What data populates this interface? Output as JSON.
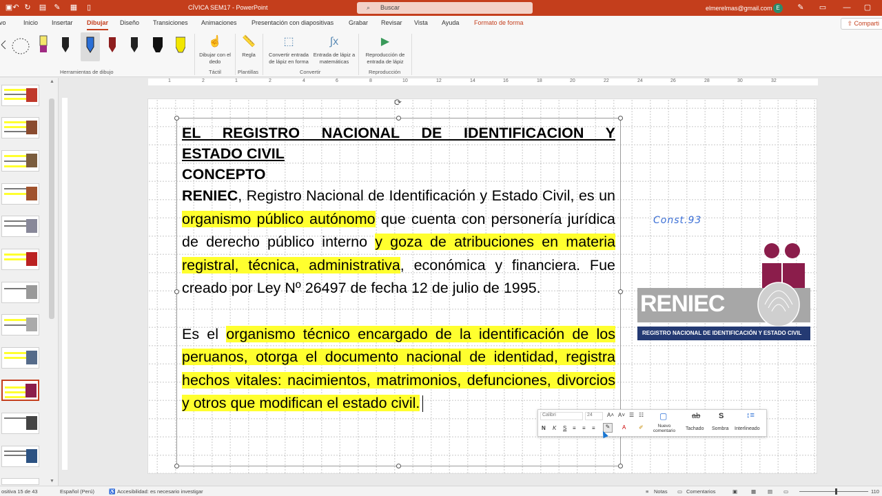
{
  "titlebar": {
    "doc_title": "CÍVICA SEM17  -  PowerPoint",
    "search_placeholder": "Buscar",
    "user_email": "elmerelmas@gmail.com",
    "user_initial": "E"
  },
  "ribbon_tabs": [
    "ivo",
    "Inicio",
    "Insertar",
    "Dibujar",
    "Diseño",
    "Transiciones",
    "Animaciones",
    "Presentación con diapositivas",
    "Grabar",
    "Revisar",
    "Vista",
    "Ayuda",
    "Formato de forma"
  ],
  "active_tab": "Dibujar",
  "share_label": "Comparti",
  "ribbon": {
    "group_drawing_tools": "Herramientas de dibujo",
    "btn_finger": "Dibujar con el dedo",
    "group_tactil": "Táctil",
    "btn_ruler": "Regla",
    "group_templates": "Plantillas",
    "btn_ink_shape": "Convertir entrada de lápiz en forma",
    "btn_ink_math": "Entrada de lápiz a matemáticas",
    "group_convert": "Convertir",
    "btn_replay": "Reproducción de entrada de lápiz",
    "group_replay": "Reproducción"
  },
  "slide_panel": {
    "slide_numbers": [
      "",
      "",
      "",
      "",
      "",
      "",
      "",
      "",
      "",
      "",
      "",
      "",
      ""
    ],
    "active_index": 9
  },
  "ruler_numbers": [
    "1",
    "2",
    "1",
    "2",
    "4",
    "6",
    "8",
    "10",
    "12",
    "14",
    "16",
    "18",
    "20",
    "22",
    "24",
    "26",
    "28",
    "30",
    "32"
  ],
  "slide": {
    "title_line1": "EL REGISTRO NACIONAL DE IDENTIFICACION Y",
    "title_line2": "ESTADO CIVIL",
    "subtitle": "CONCEPTO",
    "p1_bold": "RENIEC",
    "p1_a": ", Registro Nacional de Identificación y Estado Civil, es un ",
    "p1_hl1": "organismo público autónomo",
    "p1_b": " que cuenta con personería jurídica de derecho público interno ",
    "p1_hl2": "y goza de atribuciones en materia registral, técnica, administrativa",
    "p1_c": ", económica y financiera. Fue creado por Ley Nº 26497 de fecha 12 de julio de 1995.",
    "p2_a": "Es el ",
    "p2_hl": "organismo técnico encargado de la identificación de los peruanos, otorga el documento nacional de identidad, registra hechos vitales: nacimientos, matrimonios, defunciones, divorcios y otros que modifican el estado civil.",
    "ink_note": "Const.93",
    "logo_text": "RENIEC",
    "logo_subtitle": "REGISTRO NACIONAL DE IDENTIFICACIÓN Y ESTADO CIVIL"
  },
  "mini_toolbar": {
    "font": "Calibri",
    "size": "24",
    "bold": "N",
    "italic": "K",
    "underline": "S",
    "new_comment": "Nuevo comentario",
    "strikethrough": "Tachado",
    "shadow": "Sombra",
    "line_spacing": "Interlineado",
    "strike_icon": "ab",
    "shadow_icon": "S"
  },
  "statusbar": {
    "slide_count": "ositiva 15 de 43",
    "language": "Español (Perú)",
    "accessibility": "Accesibilidad: es necesario investigar",
    "notes": "Notas",
    "comments": "Comentarios",
    "zoom": "110"
  },
  "colors": {
    "accent": "#c43e1c",
    "highlight": "#ffff2e",
    "logo_maroon": "#8b1d4b",
    "logo_navy": "#243a73"
  }
}
